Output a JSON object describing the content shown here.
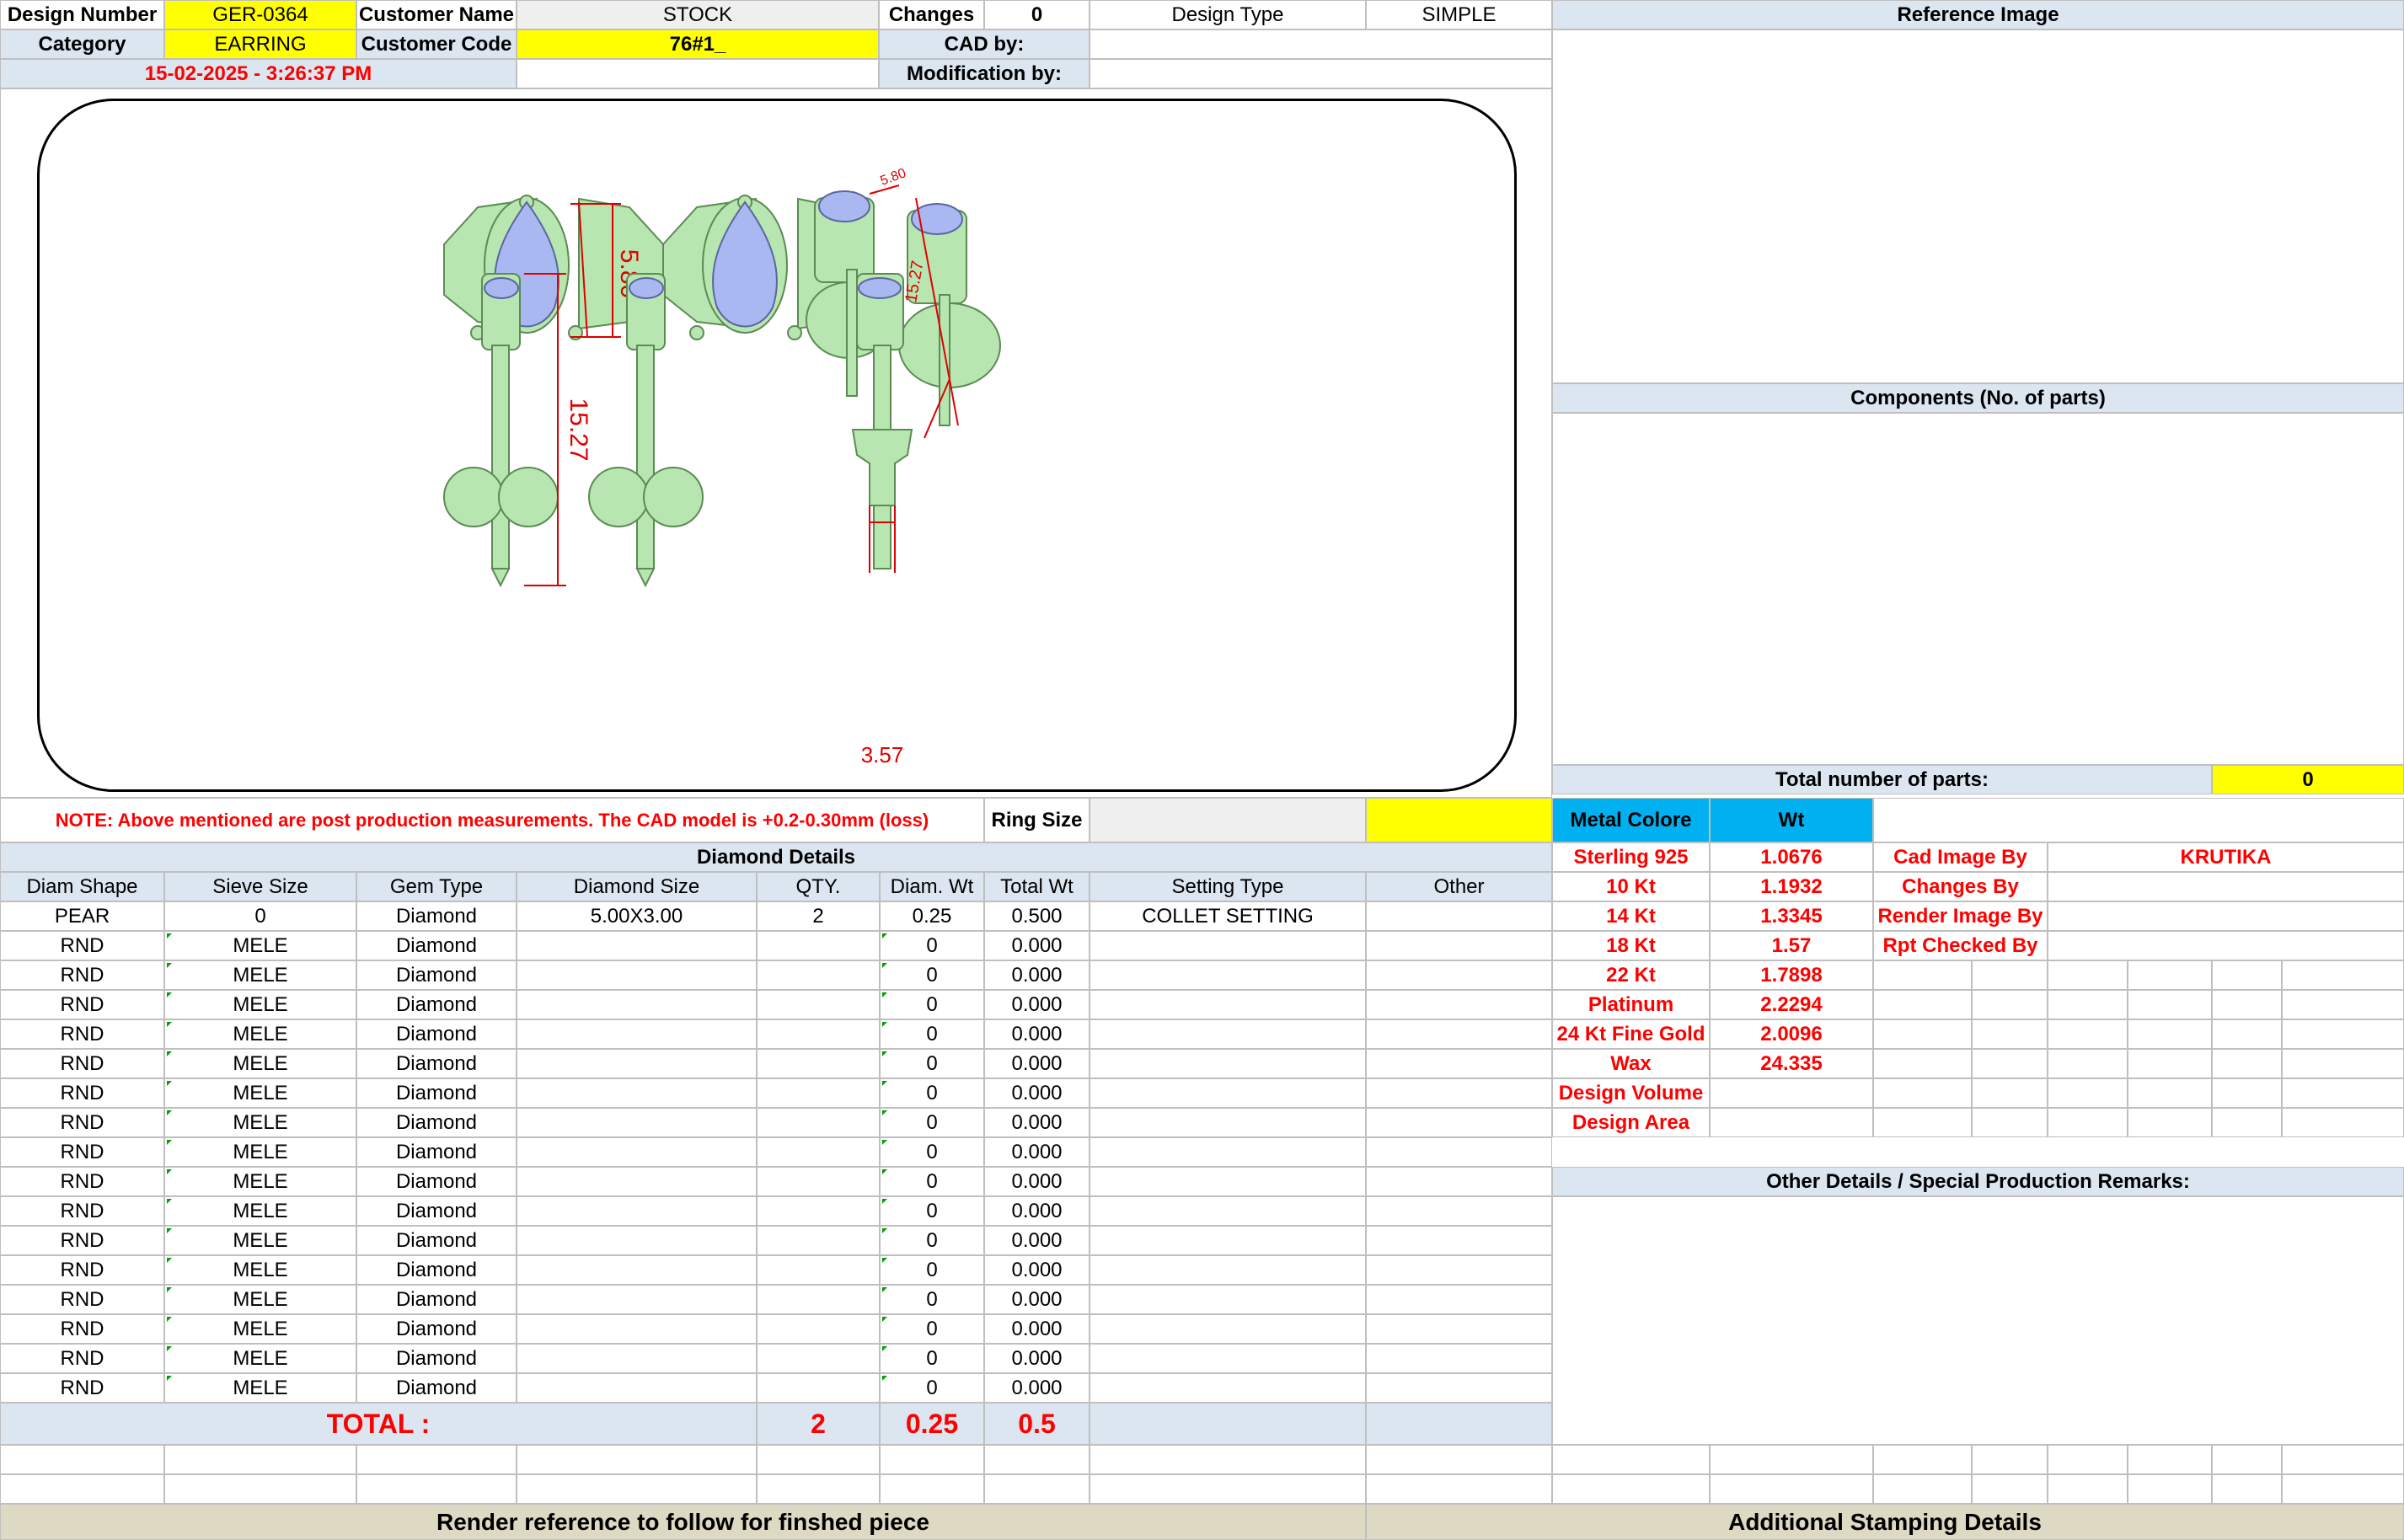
{
  "header": {
    "design_number_label": "Design Number",
    "design_number": "GER-0364",
    "customer_name_label": "Customer Name",
    "customer_name": "STOCK",
    "changes_label": "Changes",
    "changes": "0",
    "design_type_label": "Design Type",
    "design_type": "SIMPLE",
    "category_label": "Category",
    "category": "EARRING",
    "customer_code_label": "Customer Code",
    "customer_code": "76#1_",
    "cad_by_label": "CAD by:",
    "timestamp": "15-02-2025 - 3:26:37 PM",
    "modification_by_label": "Modification by:"
  },
  "drawing": {
    "dim_width": "5.80",
    "dim_height_top": "15.27",
    "dim_small_top": "5.80",
    "dim_height": "15.27",
    "dim_post": "3.57"
  },
  "right_panel": {
    "reference_image_label": "Reference Image",
    "components_label": "Components (No. of parts)",
    "total_parts_label": "Total number of parts:",
    "total_parts": "0"
  },
  "note": "NOTE: Above mentioned are post production measurements. The CAD model is +0.2-0.30mm (loss)",
  "ring_size_label": "Ring Size",
  "diamond_details_label": "Diamond Details",
  "columns": [
    "Diam Shape",
    "Sieve Size",
    "Gem Type",
    "Diamond Size",
    "QTY.",
    "Diam. Wt",
    "Total Wt",
    "Setting Type",
    "Other"
  ],
  "rows": [
    [
      "PEAR",
      "0",
      "Diamond",
      "5.00X3.00",
      "2",
      "0.25",
      "0.500",
      "COLLET SETTING",
      ""
    ],
    [
      "RND",
      "MELE",
      "Diamond",
      "",
      "",
      "0",
      "0.000",
      "",
      ""
    ],
    [
      "RND",
      "MELE",
      "Diamond",
      "",
      "",
      "0",
      "0.000",
      "",
      ""
    ],
    [
      "RND",
      "MELE",
      "Diamond",
      "",
      "",
      "0",
      "0.000",
      "",
      ""
    ],
    [
      "RND",
      "MELE",
      "Diamond",
      "",
      "",
      "0",
      "0.000",
      "",
      ""
    ],
    [
      "RND",
      "MELE",
      "Diamond",
      "",
      "",
      "0",
      "0.000",
      "",
      ""
    ],
    [
      "RND",
      "MELE",
      "Diamond",
      "",
      "",
      "0",
      "0.000",
      "",
      ""
    ],
    [
      "RND",
      "MELE",
      "Diamond",
      "",
      "",
      "0",
      "0.000",
      "",
      ""
    ],
    [
      "RND",
      "MELE",
      "Diamond",
      "",
      "",
      "0",
      "0.000",
      "",
      ""
    ],
    [
      "RND",
      "MELE",
      "Diamond",
      "",
      "",
      "0",
      "0.000",
      "",
      ""
    ],
    [
      "RND",
      "MELE",
      "Diamond",
      "",
      "",
      "0",
      "0.000",
      "",
      ""
    ],
    [
      "RND",
      "MELE",
      "Diamond",
      "",
      "",
      "0",
      "0.000",
      "",
      ""
    ],
    [
      "RND",
      "MELE",
      "Diamond",
      "",
      "",
      "0",
      "0.000",
      "",
      ""
    ],
    [
      "RND",
      "MELE",
      "Diamond",
      "",
      "",
      "0",
      "0.000",
      "",
      ""
    ],
    [
      "RND",
      "MELE",
      "Diamond",
      "",
      "",
      "0",
      "0.000",
      "",
      ""
    ],
    [
      "RND",
      "MELE",
      "Diamond",
      "",
      "",
      "0",
      "0.000",
      "",
      ""
    ],
    [
      "RND",
      "MELE",
      "Diamond",
      "",
      "",
      "0",
      "0.000",
      "",
      ""
    ]
  ],
  "total": {
    "label": "TOTAL :",
    "qty": "2",
    "diam_wt": "0.25",
    "total_wt": "0.5"
  },
  "metal": {
    "colore_label": "Metal Colore",
    "wt_label": "Wt",
    "items": [
      {
        "name": "Sterling 925",
        "wt": "1.0676"
      },
      {
        "name": "10 Kt",
        "wt": "1.1932"
      },
      {
        "name": "14 Kt",
        "wt": "1.3345"
      },
      {
        "name": "18 Kt",
        "wt": "1.57"
      },
      {
        "name": "22 Kt",
        "wt": "1.7898"
      },
      {
        "name": "Platinum",
        "wt": "2.2294"
      },
      {
        "name": "24 Kt Fine Gold",
        "wt": "2.0096"
      },
      {
        "name": "Wax",
        "wt": "24.335"
      },
      {
        "name": "Design Volume",
        "wt": ""
      },
      {
        "name": "Design Area",
        "wt": ""
      }
    ]
  },
  "credits": [
    {
      "label": "Cad Image By",
      "value": "KRUTIKA"
    },
    {
      "label": "Changes By",
      "value": ""
    },
    {
      "label": "Render Image By",
      "value": ""
    },
    {
      "label": "Rpt Checked By",
      "value": ""
    }
  ],
  "other_details_label": "Other Details / Special Production Remarks:",
  "footer": {
    "render_reference": "Render reference to follow for finshed piece",
    "stamping": "Additional Stamping Details"
  },
  "colors": {
    "yellow": "#ffff00",
    "header_blue": "#dce6f1",
    "metal_blue": "#00b0f0",
    "red": "#ff0000",
    "metal_green": "#b7e6b0",
    "stone_blue": "#a9b8f0"
  }
}
